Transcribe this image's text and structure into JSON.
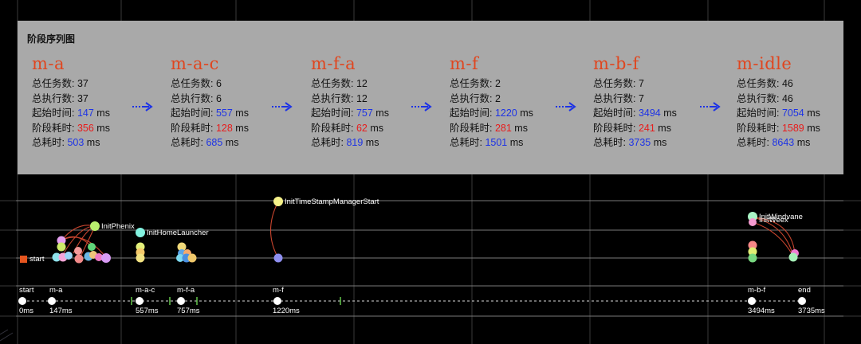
{
  "panel": {
    "title": "阶段序列图",
    "labels": {
      "task_count": "总任务数: ",
      "exec_count": "总执行数: ",
      "start_time": "起始时间: ",
      "phase_time": "阶段耗时: ",
      "total_time": "总耗时: ",
      "unit": " ms"
    },
    "phases": [
      {
        "name": "m-a",
        "task_count": "37",
        "exec_count": "37",
        "start_time": "147",
        "phase_time": "356",
        "total_time": "503"
      },
      {
        "name": "m-a-c",
        "task_count": "6",
        "exec_count": "6",
        "start_time": "557",
        "phase_time": "128",
        "total_time": "685"
      },
      {
        "name": "m-f-a",
        "task_count": "12",
        "exec_count": "12",
        "start_time": "757",
        "phase_time": "62",
        "total_time": "819"
      },
      {
        "name": "m-f",
        "task_count": "2",
        "exec_count": "2",
        "start_time": "1220",
        "phase_time": "281",
        "total_time": "1501"
      },
      {
        "name": "m-b-f",
        "task_count": "7",
        "exec_count": "7",
        "start_time": "3494",
        "phase_time": "241",
        "total_time": "3735"
      },
      {
        "name": "m-idle",
        "task_count": "46",
        "exec_count": "46",
        "start_time": "7054",
        "phase_time": "1589",
        "total_time": "8643"
      }
    ],
    "colors": {
      "phase_name": "#e0461f",
      "start_value": "#1d33e6",
      "phase_value": "#e81c1c",
      "arrow": "#1d33e6"
    }
  },
  "timeline": {
    "milestones": [
      {
        "label": "start",
        "time": "0ms"
      },
      {
        "label": "m-a",
        "time": "147ms"
      },
      {
        "label": "m-a-c",
        "time": "557ms"
      },
      {
        "label": "m-f-a",
        "time": "757ms"
      },
      {
        "label": "m-f",
        "time": "1220ms"
      },
      {
        "label": "m-b-f",
        "time": "3494ms"
      },
      {
        "label": "end",
        "time": "3735ms"
      }
    ],
    "task_labels": {
      "start": "start",
      "phenix": "InitPhenix",
      "home": "InitHomeLauncher",
      "timestamp": "InitTimeStampManagerStart",
      "windvane": "InitWindvane",
      "weex": "InitWeex"
    }
  }
}
